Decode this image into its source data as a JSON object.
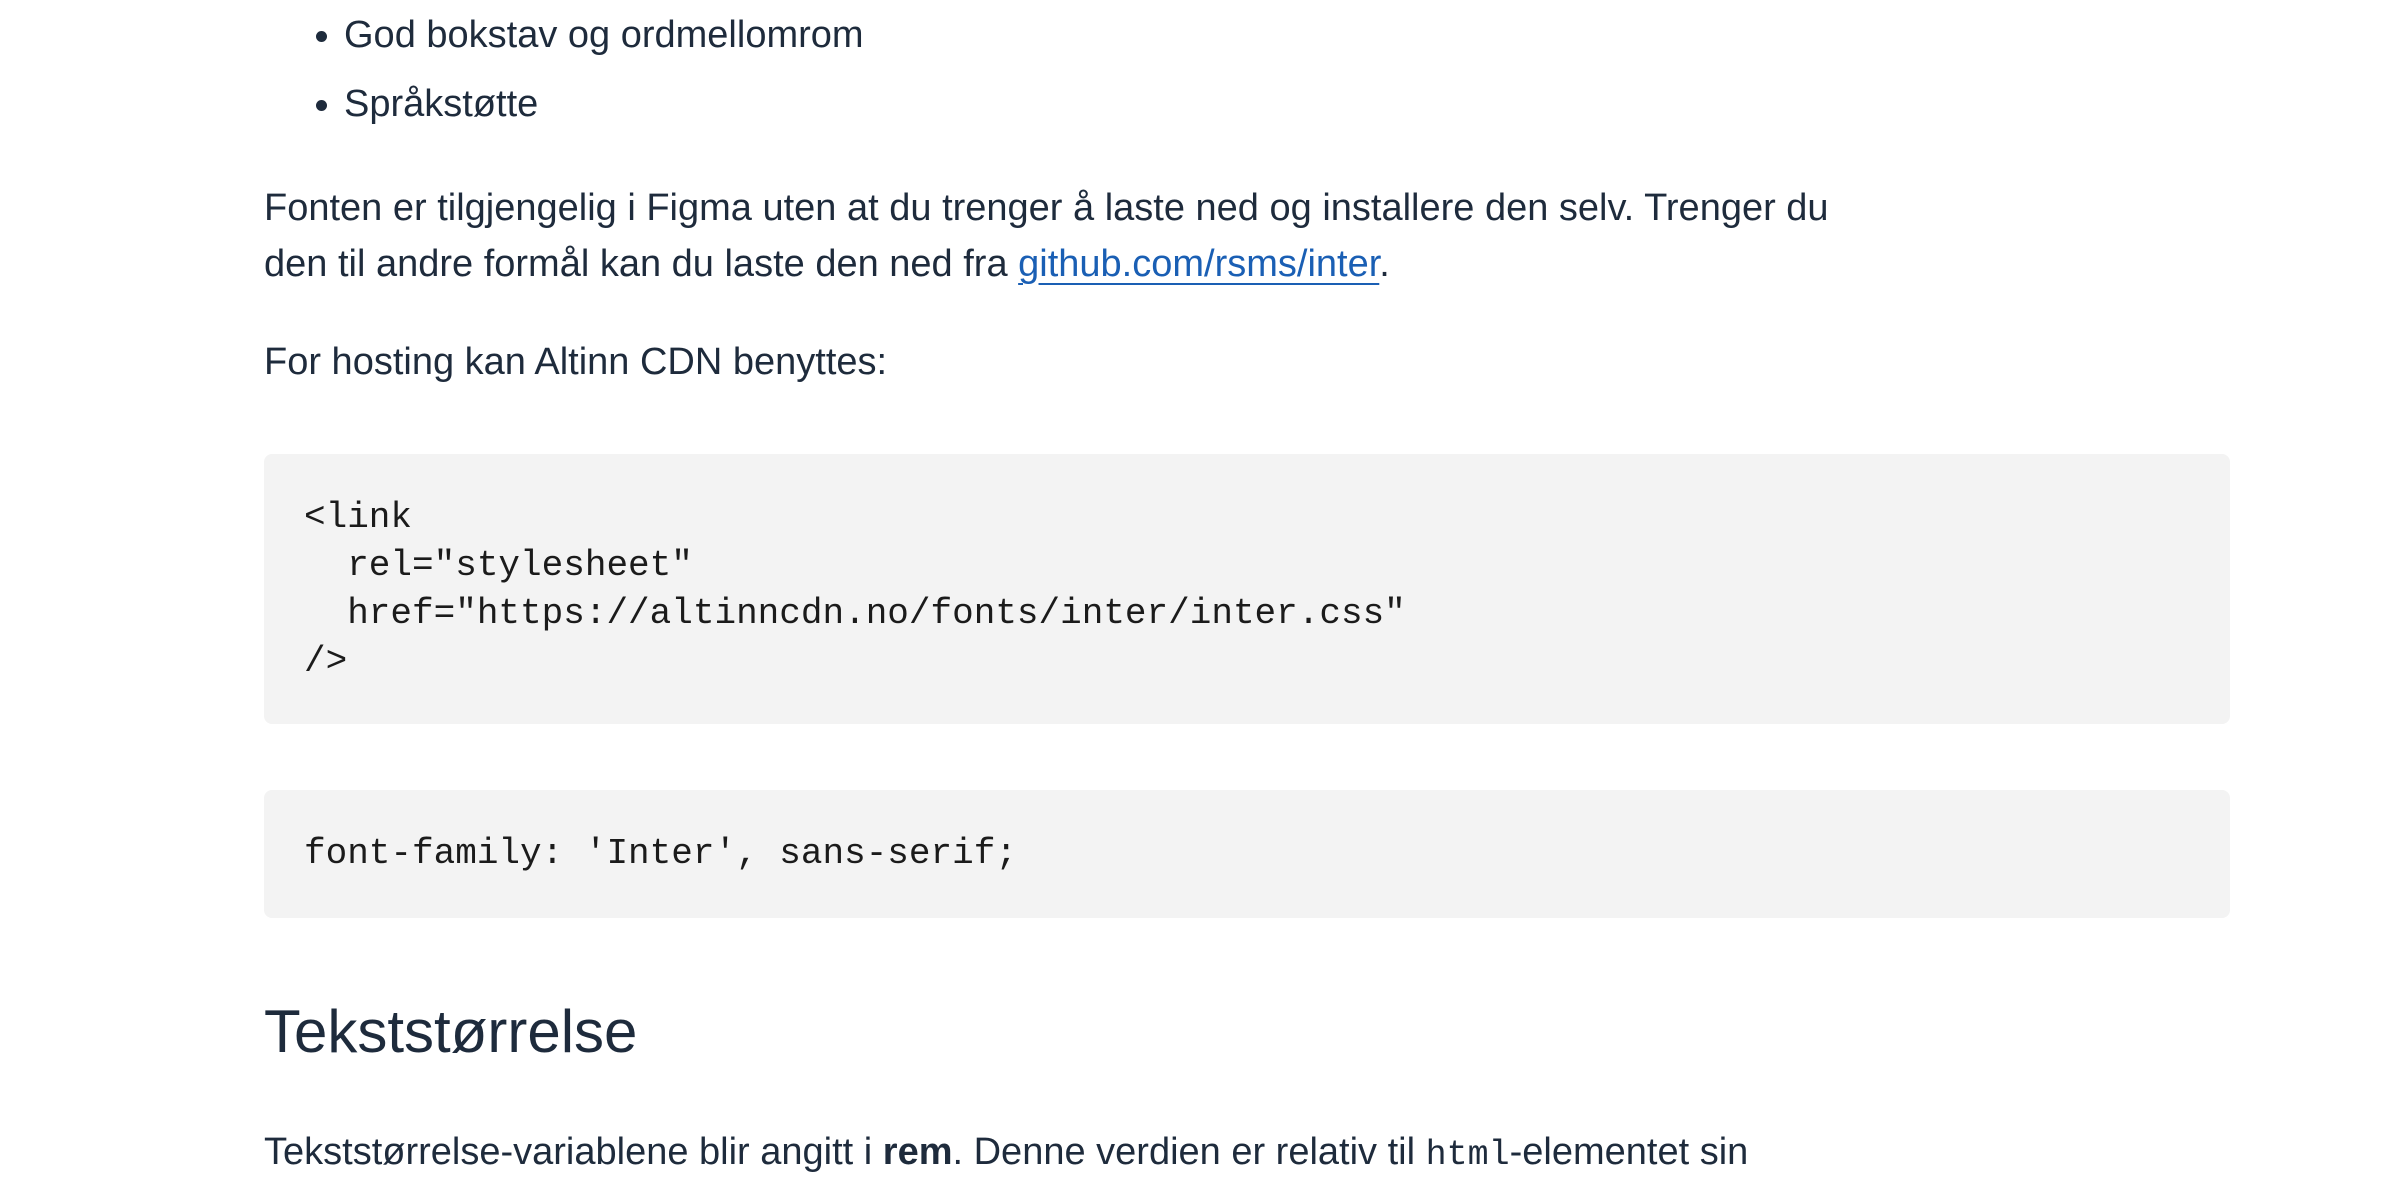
{
  "bullets": [
    "God bokstav og ordmellomrom",
    "Språkstøtte"
  ],
  "para1": {
    "text_before": "Fonten er tilgjengelig i Figma uten at du trenger å laste ned og installere den selv. Trenger du den til andre formål kan du laste den ned fra ",
    "link_text": "github.com/rsms/inter",
    "text_after": "."
  },
  "para2": {
    "text": "For hosting kan Altinn CDN benyttes:"
  },
  "code1": {
    "text": "<link\n  rel=\"stylesheet\"\n  href=\"https://altinncdn.no/fonts/inter/inter.css\"\n/>"
  },
  "code2": {
    "text": "font-family: 'Inter', sans-serif;"
  },
  "heading": {
    "text": "Tekststørrelse"
  },
  "para3": {
    "part1": "Tekststørrelse-variablene blir angitt i ",
    "strong": "rem",
    "part2": ". Denne verdien er relativ til ",
    "code": "html",
    "part3": "-elementet sin"
  }
}
